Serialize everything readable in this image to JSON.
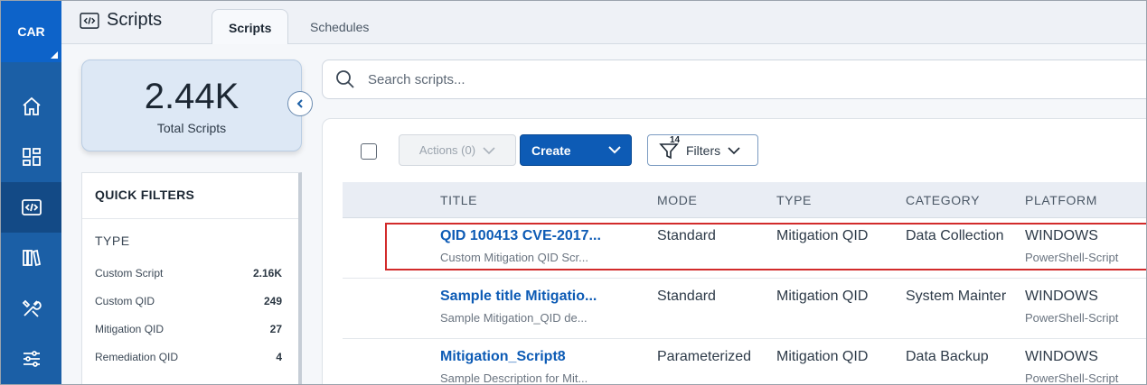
{
  "rail": {
    "brand": "CAR",
    "items": [
      {
        "icon": "home-icon"
      },
      {
        "icon": "dashboard-icon"
      },
      {
        "icon": "scripts-icon"
      },
      {
        "icon": "library-icon"
      },
      {
        "icon": "tools-icon"
      },
      {
        "icon": "settings-sliders-icon"
      }
    ]
  },
  "header": {
    "title": "Scripts",
    "tabs": [
      {
        "label": "Scripts",
        "active": true
      },
      {
        "label": "Schedules",
        "active": false
      }
    ]
  },
  "summary": {
    "value": "2.44K",
    "label": "Total Scripts"
  },
  "quick_filters": {
    "title": "QUICK FILTERS",
    "section": "TYPE",
    "items": [
      {
        "label": "Custom Script",
        "count": "2.16K"
      },
      {
        "label": "Custom QID",
        "count": "249"
      },
      {
        "label": "Mitigation QID",
        "count": "27"
      },
      {
        "label": "Remediation QID",
        "count": "4"
      }
    ]
  },
  "search": {
    "placeholder": "Search scripts..."
  },
  "toolbar": {
    "actions_label": "Actions (0)",
    "create_label": "Create",
    "filters_label": "Filters",
    "filters_count": "14"
  },
  "table": {
    "columns": [
      "TITLE",
      "MODE",
      "TYPE",
      "CATEGORY",
      "PLATFORM"
    ],
    "rows": [
      {
        "title": "QID 100413 CVE-2017...",
        "description": "Custom Mitigation QID Scr...",
        "mode": "Standard",
        "type": "Mitigation QID",
        "category": "Data Collection",
        "platform": "WINDOWS",
        "platform_sub": "PowerShell-Script"
      },
      {
        "title": "Sample title Mitigatio...",
        "description": "Sample Mitigation_QID de...",
        "mode": "Standard",
        "type": "Mitigation QID",
        "category": "System Mainter",
        "platform": "WINDOWS",
        "platform_sub": "PowerShell-Script"
      },
      {
        "title": "Mitigation_Script8",
        "description": "Sample Description for Mit...",
        "mode": "Parameterized",
        "type": "Mitigation QID",
        "category": "Data Backup",
        "platform": "WINDOWS",
        "platform_sub": "PowerShell-Script"
      }
    ]
  },
  "colors": {
    "rail": "#1b5fa6",
    "brand": "#0d63c9",
    "accent": "#0d5bb5",
    "highlight": "#d22b2b"
  }
}
